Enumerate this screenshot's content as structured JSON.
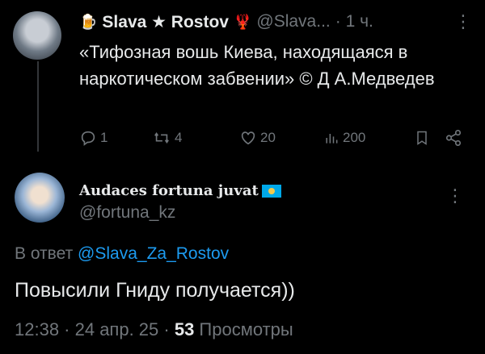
{
  "tweet1": {
    "author_name": "Slava ★ Rostov",
    "author_handle": "@Slava...",
    "time": "· 1 ч.",
    "text": "«Тифозная вошь Киева, находящаяся в наркотическом забвении» © Д А.Медведев",
    "actions": {
      "replies": "1",
      "reposts": "4",
      "likes": "20",
      "views": "200"
    }
  },
  "tweet2": {
    "author_name": "Audaces fortuna juvat",
    "author_handle": "@fortuna_kz",
    "reply_prefix": "В ответ ",
    "reply_to": "@Slava_Za_Rostov",
    "text": "Повысили Гниду получается))",
    "time": "12:38 · 24 апр. 25 · ",
    "views_count": "53",
    "views_label": " Просмотры"
  },
  "icons": {
    "more": "more-icon",
    "reply": "reply-icon",
    "repost": "repost-icon",
    "like": "heart-icon",
    "views": "views-icon",
    "bookmark": "bookmark-icon",
    "share": "share-icon"
  },
  "colors": {
    "background": "#000000",
    "text": "#e7e9ea",
    "muted": "#71767b",
    "link": "#1d9bf0"
  }
}
